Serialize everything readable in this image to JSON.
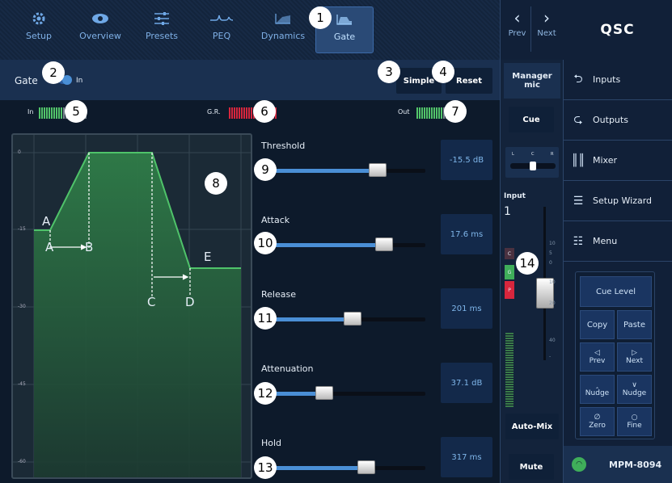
{
  "tabs": [
    {
      "label": "Setup",
      "icon": "gear-icon"
    },
    {
      "label": "Overview",
      "icon": "eye-icon"
    },
    {
      "label": "Presets",
      "icon": "sliders-icon"
    },
    {
      "label": "PEQ",
      "icon": "eq-curve-icon"
    },
    {
      "label": "Dynamics",
      "icon": "dynamics-icon"
    },
    {
      "label": "Gate",
      "icon": "gate-icon",
      "active": true
    }
  ],
  "nav": {
    "prev": "Prev",
    "next": "Next"
  },
  "brand": "QSC",
  "gate": {
    "label": "Gate",
    "toggle_label": "In",
    "simple": "Simple",
    "reset": "Reset"
  },
  "meters": {
    "in": "In",
    "gr": "G.R.",
    "out": "Out"
  },
  "graph": {
    "y_ticks": [
      "0",
      "-15",
      "-30",
      "-45",
      "-60"
    ],
    "points": [
      "A",
      "B",
      "C",
      "D",
      "E"
    ]
  },
  "sliders": [
    {
      "label": "Threshold",
      "value": "-15.5 dB",
      "level": 0.7
    },
    {
      "label": "Attack",
      "value": "17.6 ms",
      "level": 0.74
    },
    {
      "label": "Release",
      "value": "201 ms",
      "level": 0.54
    },
    {
      "label": "Attenuation",
      "value": "37.1 dB",
      "level": 0.36
    },
    {
      "label": "Hold",
      "value": "317 ms",
      "level": 0.63
    }
  ],
  "strip": {
    "title": "Manager mic",
    "cue": "Cue",
    "pan_labels": [
      "L",
      "C",
      "R"
    ],
    "input_label": "Input",
    "input_number": "1",
    "ind_c": "C",
    "ind_g": "G",
    "ind_p": "P",
    "fader_ticks": [
      "10",
      "5",
      "0",
      "10",
      "20",
      "40",
      "-"
    ],
    "automix": "Auto-Mix",
    "mute": "Mute"
  },
  "menu": [
    {
      "label": "Inputs",
      "icon": "inputs-icon"
    },
    {
      "label": "Outputs",
      "icon": "outputs-icon"
    },
    {
      "label": "Mixer",
      "icon": "mixer-icon"
    },
    {
      "label": "Setup Wizard",
      "icon": "wizard-icon"
    },
    {
      "label": "Menu",
      "icon": "menu-icon"
    }
  ],
  "pads": {
    "cue_level": "Cue Level",
    "copy": "Copy",
    "paste": "Paste",
    "prev": "Prev",
    "next": "Next",
    "nudge_up": "Nudge",
    "nudge_down": "Nudge",
    "zero": "Zero",
    "fine": "Fine"
  },
  "device": "MPM-8094",
  "badges": [
    "1",
    "2",
    "3",
    "4",
    "5",
    "6",
    "7",
    "8",
    "9",
    "10",
    "11",
    "12",
    "13",
    "14"
  ],
  "colors": {
    "accent": "#4a8fd6",
    "curve": "#3fae5a",
    "gr_red": "#d7263d",
    "meter_green": "#52c46a"
  }
}
